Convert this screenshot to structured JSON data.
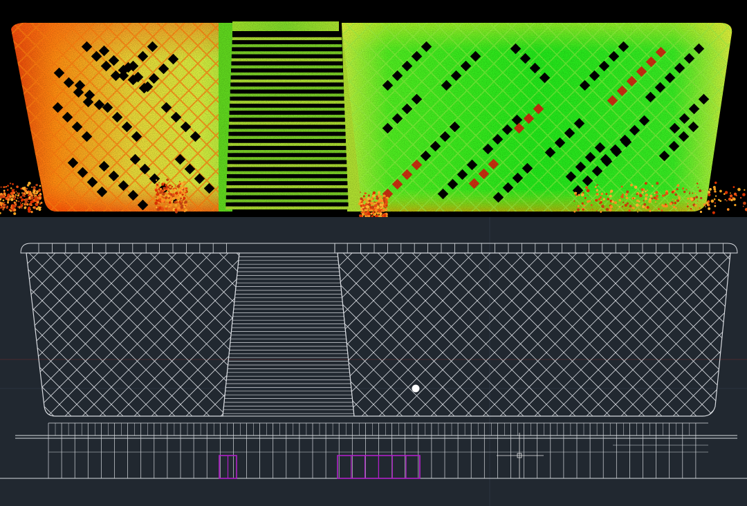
{
  "scan_view": {
    "background": "#000000",
    "colormap": [
      "#e21b00",
      "#ff7a00",
      "#ffd200",
      "#c8ff3a",
      "#18f000"
    ],
    "left_dominant": "#f0c030",
    "right_dominant": "#22e020"
  },
  "cad_view": {
    "background": "#212830",
    "line_color": "#d8dbe0",
    "door_color": "#b020c8",
    "axis_color": "#4a2a2e",
    "marker_color": "#ffffff"
  }
}
